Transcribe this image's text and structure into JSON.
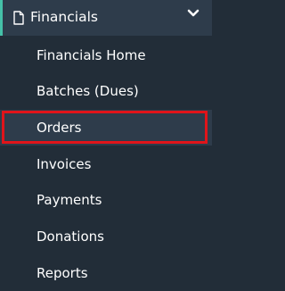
{
  "section": {
    "label": "Financials",
    "icon": "document-icon",
    "toggle_icon": "chevron-down-icon",
    "accent_color": "#45c1a8"
  },
  "menu": {
    "items": [
      {
        "label": "Financials Home"
      },
      {
        "label": "Batches (Dues)"
      },
      {
        "label": "Orders",
        "active": true
      },
      {
        "label": "Invoices"
      },
      {
        "label": "Payments"
      },
      {
        "label": "Donations"
      },
      {
        "label": "Reports"
      }
    ]
  },
  "highlight": {
    "color": "#e0141a",
    "target": "Orders"
  }
}
